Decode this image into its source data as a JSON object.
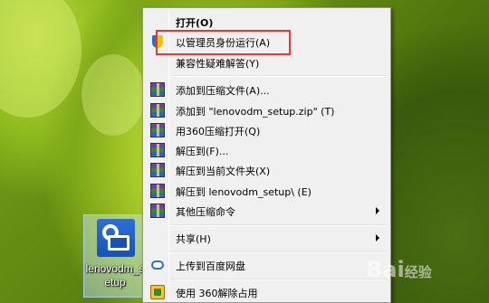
{
  "desktop": {
    "icon_label": "lenovodm_setup"
  },
  "context_menu": {
    "items": [
      {
        "label": "打开(O)",
        "icon": "none",
        "bold": true
      },
      {
        "label": "以管理员身份运行(A)",
        "icon": "shield-icon"
      },
      {
        "label": "兼容性疑难解答(Y)",
        "icon": "none"
      },
      {
        "label": "添加到压缩文件(A)...",
        "icon": "archive-icon"
      },
      {
        "label": "添加到 \"lenovodm_setup.zip\" (T)",
        "icon": "archive-icon"
      },
      {
        "label": "用360压缩打开(Q)",
        "icon": "archive-icon"
      },
      {
        "label": "解压到(F)...",
        "icon": "archive-icon"
      },
      {
        "label": "解压到当前文件夹(X)",
        "icon": "archive-icon"
      },
      {
        "label": "解压到 lenovodm_setup\\ (E)",
        "icon": "archive-icon"
      },
      {
        "label": "其他压缩命令",
        "icon": "archive-icon",
        "submenu": true
      },
      {
        "label": "共享(H)",
        "icon": "none",
        "submenu": true
      },
      {
        "label": "上传到百度网盘",
        "icon": "cloud-icon"
      },
      {
        "label": "使用 360解除占用",
        "icon": "unlock-icon"
      }
    ]
  },
  "annotation": {
    "highlight_color": "#e53935"
  },
  "watermark": {
    "text": "Bai",
    "suffix": "经验"
  }
}
